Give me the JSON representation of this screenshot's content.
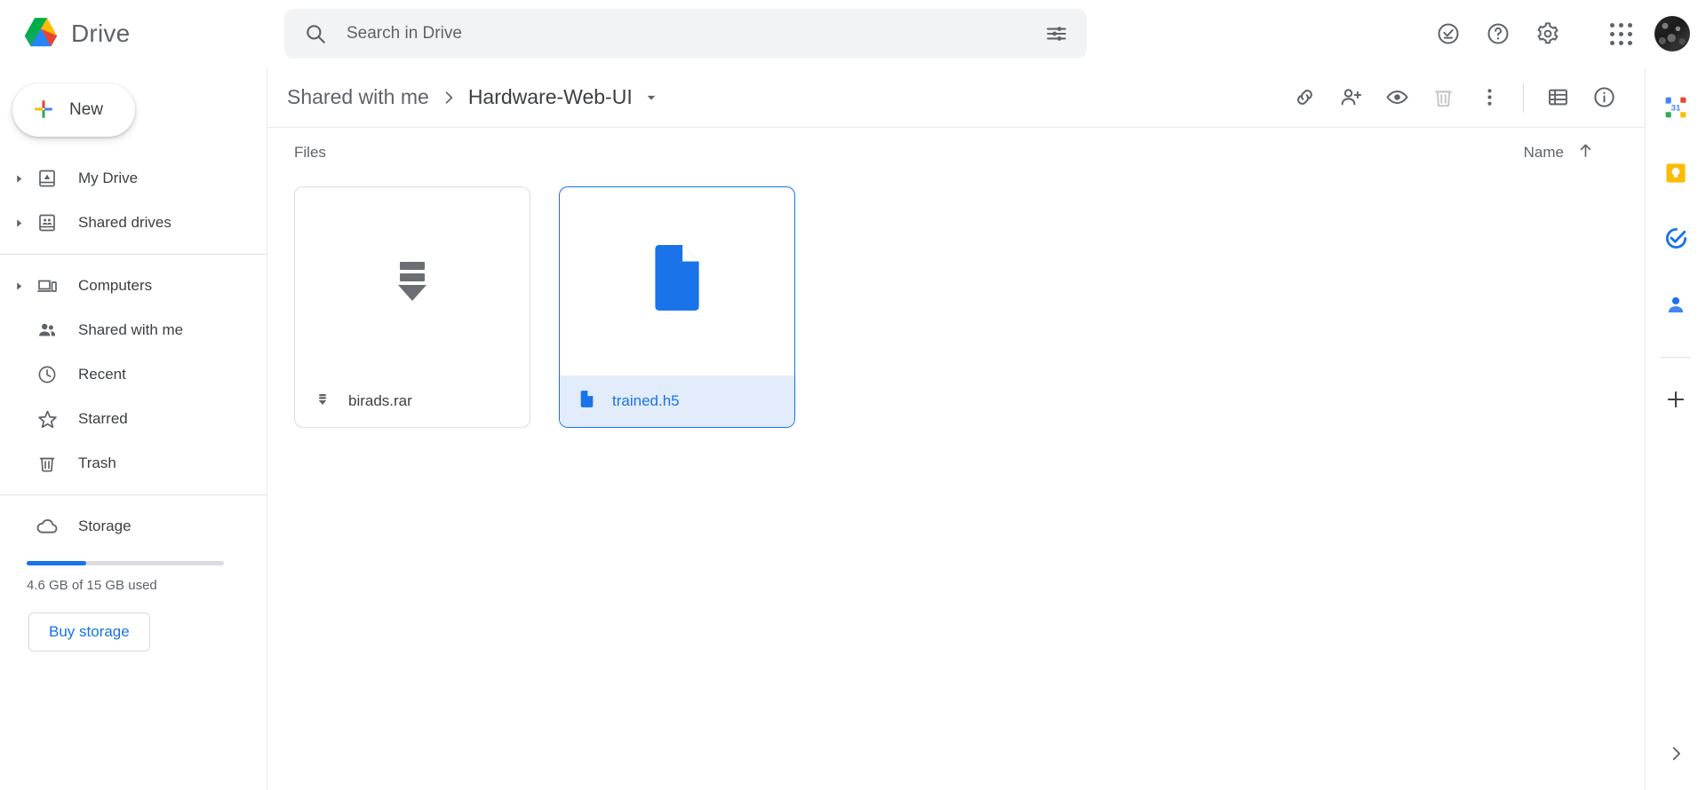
{
  "app": {
    "name": "Drive",
    "logo_icon": "google-drive-logo"
  },
  "search": {
    "placeholder": "Search in Drive",
    "value": "",
    "search_icon": "search-icon",
    "filter_icon": "tune-filter-icon"
  },
  "header_actions": [
    {
      "name": "activity-button",
      "icon": "check-circle-icon"
    },
    {
      "name": "support-button",
      "icon": "help-circle-icon"
    },
    {
      "name": "settings-button",
      "icon": "gear-icon"
    },
    {
      "name": "google-apps-button",
      "icon": "apps-grid-icon"
    },
    {
      "name": "account-avatar",
      "icon": "avatar-icon"
    }
  ],
  "sidebar": {
    "new_button": {
      "label": "New",
      "icon": "plus-icon"
    },
    "items": [
      {
        "label": "My Drive",
        "icon": "my-drive-icon",
        "expandable": true
      },
      {
        "label": "Shared drives",
        "icon": "shared-drives-icon",
        "expandable": true
      },
      {
        "label": "Computers",
        "icon": "computers-icon",
        "expandable": true
      },
      {
        "label": "Shared with me",
        "icon": "people-icon",
        "expandable": false
      },
      {
        "label": "Recent",
        "icon": "clock-icon",
        "expandable": false
      },
      {
        "label": "Starred",
        "icon": "star-icon",
        "expandable": false
      },
      {
        "label": "Trash",
        "icon": "trash-icon",
        "expandable": false
      }
    ],
    "storage": {
      "label": "Storage",
      "icon": "cloud-icon",
      "usage_text": "4.6 GB of 15 GB used",
      "used_percent": 30,
      "buy_label": "Buy storage",
      "accent_color": "#1a73e8"
    }
  },
  "breadcrumb": {
    "parent": "Shared with me",
    "current": "Hardware-Web-UI",
    "separator_icon": "chevron-right-icon",
    "dropdown_icon": "caret-down-icon"
  },
  "toolbar": [
    {
      "name": "get-link-button",
      "icon": "link-icon"
    },
    {
      "name": "share-button",
      "icon": "person-add-icon"
    },
    {
      "name": "preview-button",
      "icon": "eye-icon"
    },
    {
      "name": "remove-button",
      "icon": "trash-icon"
    },
    {
      "name": "more-actions-button",
      "icon": "more-vertical-icon"
    },
    {
      "name": "list-view-button",
      "icon": "list-view-icon"
    },
    {
      "name": "details-button",
      "icon": "info-circle-icon"
    }
  ],
  "files_section": {
    "title": "Files",
    "sort": {
      "label": "Name",
      "direction_icon": "arrow-up-icon"
    },
    "items": [
      {
        "name": "birads.rar",
        "icon": "archive-icon",
        "selected": false
      },
      {
        "name": "trained.h5",
        "icon": "generic-file-icon",
        "selected": true
      }
    ]
  },
  "right_rail": [
    {
      "name": "google-calendar-button",
      "icon": "calendar-31-icon"
    },
    {
      "name": "google-keep-button",
      "icon": "keep-bulb-icon"
    },
    {
      "name": "google-tasks-button",
      "icon": "tasks-check-icon"
    },
    {
      "name": "google-contacts-button",
      "icon": "contacts-person-icon"
    },
    {
      "name": "add-addon-button",
      "icon": "plus-icon"
    }
  ],
  "rail_expand": {
    "name": "expand-panel-button",
    "icon": "chevron-right-icon"
  }
}
